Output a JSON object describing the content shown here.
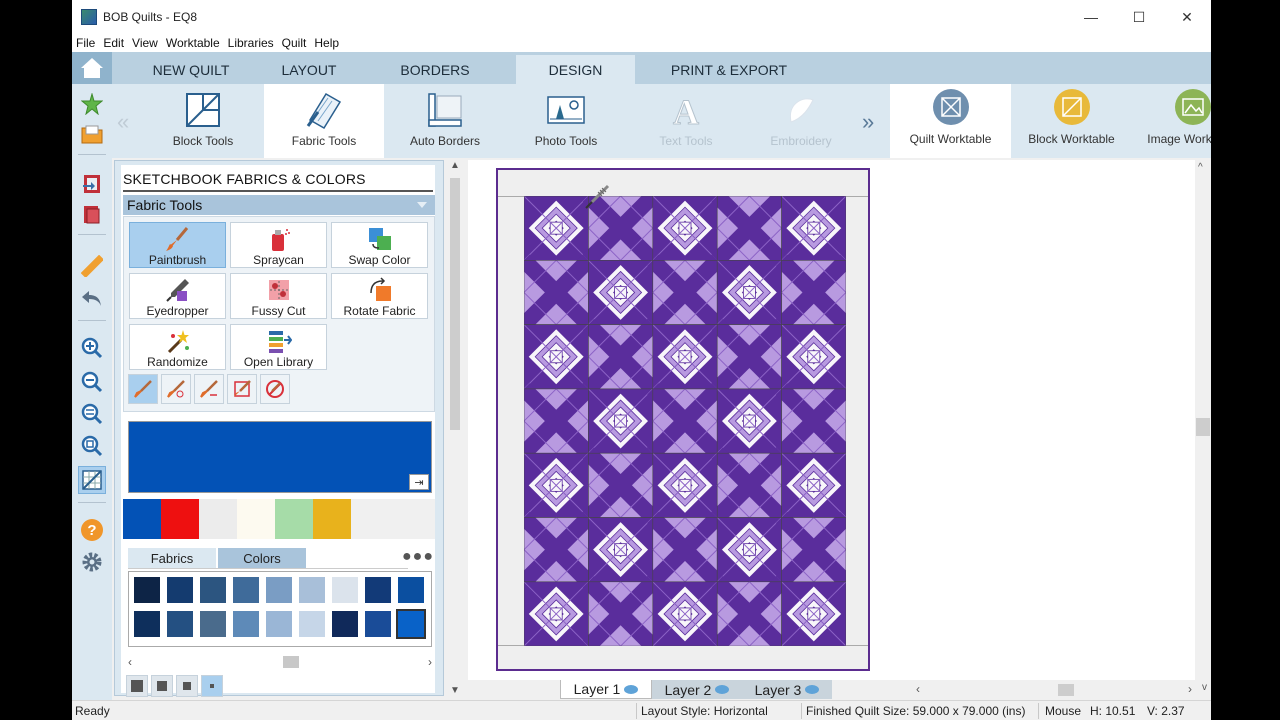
{
  "window": {
    "title": "BOB Quilts - EQ8",
    "controls": {
      "minimize": "—",
      "maximize": "☐",
      "close": "✕"
    }
  },
  "menu": [
    "File",
    "Edit",
    "View",
    "Worktable",
    "Libraries",
    "Quilt",
    "Help"
  ],
  "tabs": [
    "NEW QUILT",
    "LAYOUT",
    "BORDERS",
    "DESIGN",
    "PRINT & EXPORT"
  ],
  "active_tab": "DESIGN",
  "ribbon": {
    "tools": [
      {
        "label": "Block Tools",
        "icon": "block-tools-icon"
      },
      {
        "label": "Fabric Tools",
        "icon": "fabric-tools-icon"
      },
      {
        "label": "Auto Borders",
        "icon": "auto-borders-icon"
      },
      {
        "label": "Photo Tools",
        "icon": "photo-tools-icon"
      },
      {
        "label": "Text Tools",
        "icon": "text-tools-icon"
      },
      {
        "label": "Embroidery",
        "icon": "embroidery-icon"
      }
    ],
    "worktables": [
      {
        "label": "Quilt Worktable",
        "color": "#6f8fae"
      },
      {
        "label": "Block Worktable",
        "color": "#e8b93a"
      },
      {
        "label": "Image Worktable",
        "color": "#8db456"
      }
    ]
  },
  "panel": {
    "title": "SKETCHBOOK FABRICS & COLORS",
    "section": "Fabric Tools",
    "tools": [
      {
        "label": "Paintbrush",
        "icon": "paintbrush-icon"
      },
      {
        "label": "Spraycan",
        "icon": "spraycan-icon"
      },
      {
        "label": "Swap Color",
        "icon": "swap-color-icon"
      },
      {
        "label": "Eyedropper",
        "icon": "eyedropper-icon"
      },
      {
        "label": "Fussy Cut",
        "icon": "fussy-cut-icon"
      },
      {
        "label": "Rotate Fabric",
        "icon": "rotate-fabric-icon"
      },
      {
        "label": "Randomize",
        "icon": "randomize-icon"
      },
      {
        "label": "Open Library",
        "icon": "open-library-icon"
      }
    ],
    "current_color": "#0352b6",
    "recent_colors": [
      "#0352b6",
      "#ee1010",
      "#ececec",
      "#fdfaf0",
      "#a6dca8",
      "#e8b21c"
    ],
    "subtabs": [
      "Fabrics",
      "Colors"
    ],
    "active_subtab": "Colors",
    "palette_row1": [
      "#0d2446",
      "#143b6f",
      "#2c5580",
      "#3f6b9a",
      "#7a9dc4",
      "#a8bfd9",
      "#dbe3ec",
      "#123a78",
      "#0b4fa0"
    ],
    "palette_row2": [
      "#0e2f5c",
      "#245082",
      "#4a6b8c",
      "#5e8ab8",
      "#9ab6d6",
      "#c6d6e8",
      "#10295a",
      "#1a4c98",
      "#0962c8"
    ]
  },
  "layers": [
    {
      "label": "Layer 1"
    },
    {
      "label": "Layer 2"
    },
    {
      "label": "Layer 3"
    }
  ],
  "status": {
    "ready": "Ready",
    "layout_style": "Layout Style: Horizontal",
    "finished_size": "Finished Quilt Size: 59.000 x 79.000 (ins)",
    "mouse": "Mouse",
    "h": "H:  10.51",
    "v": "V:  2.37"
  },
  "quilt_colors": {
    "dark": "#5a2d9c",
    "mid": "#8c63c6",
    "light": "#b89ae0",
    "cream": "#f8f6fa"
  }
}
